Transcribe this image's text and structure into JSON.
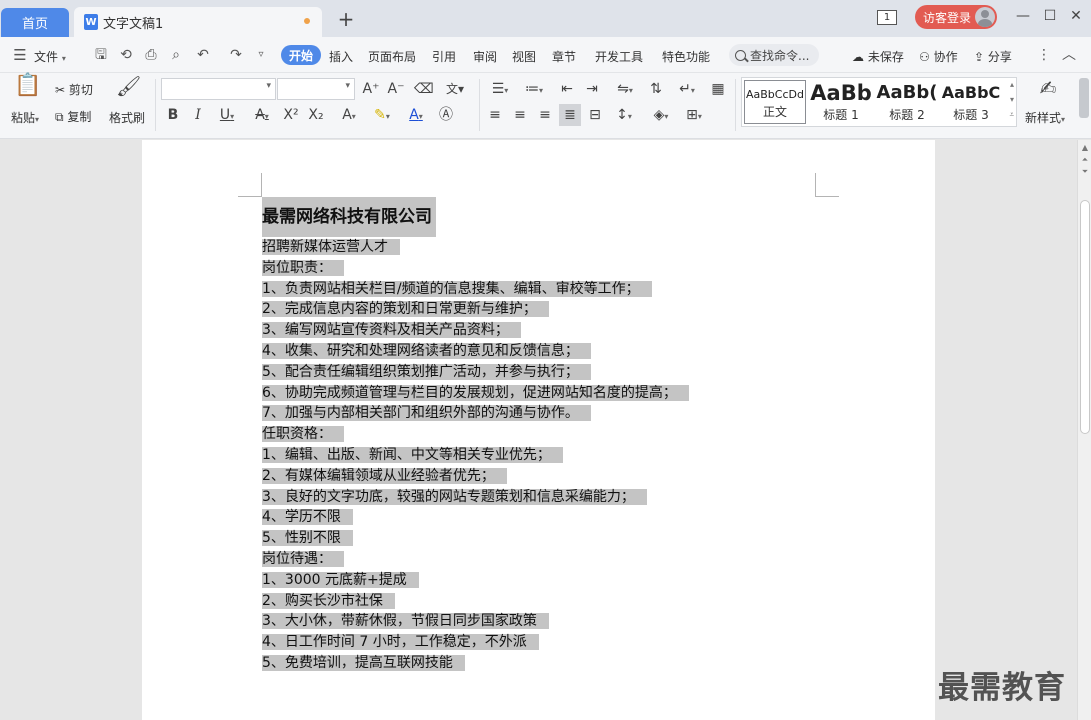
{
  "tabs": {
    "home": "首页",
    "doc": "文字文稿1",
    "doc_icon": "W",
    "add": "+"
  },
  "titlebar": {
    "window_count": "1",
    "login": "访客登录",
    "minimize": "—",
    "maximize": "☐",
    "close": "✕"
  },
  "menubar": {
    "file": "文件",
    "items": [
      "开始",
      "插入",
      "页面布局",
      "引用",
      "审阅",
      "视图",
      "章节",
      "开发工具",
      "特色功能"
    ],
    "search": "查找命令...",
    "unsaved": "未保存",
    "collab": "协作",
    "share": "分享"
  },
  "ribbon": {
    "paste": "粘贴",
    "cut": "剪切",
    "copy": "复制",
    "format_painter": "格式刷",
    "font_name": "",
    "font_size": "",
    "styles": [
      {
        "preview": "AaBbCcDd",
        "label": "正文"
      },
      {
        "preview": "AaBb",
        "label": "标题 1"
      },
      {
        "preview": "AaBb(",
        "label": "标题 2"
      },
      {
        "preview": "AaBbC",
        "label": "标题 3"
      }
    ],
    "new_style": "新样式"
  },
  "document": {
    "title": "最需网络科技有限公司",
    "lines": [
      "招聘新媒体运营人才",
      "岗位职责：",
      "1、负责网站相关栏目/频道的信息搜集、编辑、审校等工作；",
      "2、完成信息内容的策划和日常更新与维护；",
      "3、编写网站宣传资料及相关产品资料；",
      "4、收集、研究和处理网络读者的意见和反馈信息；",
      "5、配合责任编辑组织策划推广活动，并参与执行；",
      "6、协助完成频道管理与栏目的发展规划，促进网站知名度的提高；",
      "7、加强与内部相关部门和组织外部的沟通与协作。",
      "任职资格：",
      "1、编辑、出版、新闻、中文等相关专业优先；",
      "2、有媒体编辑领域从业经验者优先；",
      "3、良好的文字功底，较强的网站专题策划和信息采编能力；",
      "4、学历不限",
      "5、性别不限",
      "岗位待遇：",
      "1、3000 元底薪+提成",
      "2、购买长沙市社保",
      "3、大小休，带薪休假，节假日同步国家政策",
      "4、日工作时间 7 小时，工作稳定，不外派",
      "5、免费培训，提高互联网技能"
    ]
  },
  "watermark": "最需教育"
}
